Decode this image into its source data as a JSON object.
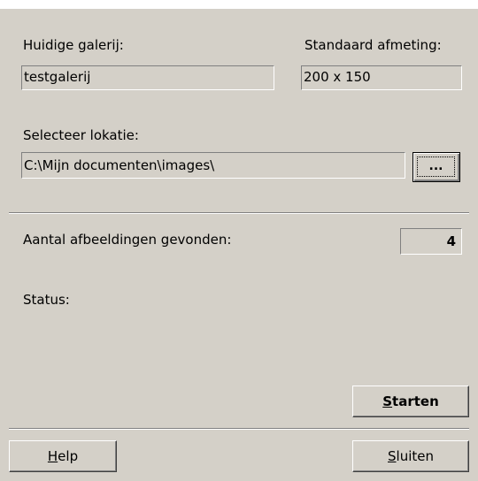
{
  "gallery": {
    "current_label": "Huidige galerij:",
    "current_value": "testgalerij",
    "size_label": "Standaard afmeting:",
    "size_value": "200 x 150"
  },
  "location": {
    "label": "Selecteer lokatie:",
    "value": "C:\\Mijn documenten\\images\\",
    "browse_label": "..."
  },
  "results": {
    "count_label": "Aantal afbeeldingen gevonden:",
    "count_value": "4",
    "status_label": "Status:"
  },
  "buttons": {
    "start_accel": "S",
    "start_rest": "tarten",
    "help_accel": "H",
    "help_rest": "elp",
    "close_accel": "S",
    "close_rest": "luiten"
  },
  "colors": {
    "dialog_bg": "#d4d0c8",
    "shadow": "#808080",
    "highlight": "#ffffff"
  }
}
